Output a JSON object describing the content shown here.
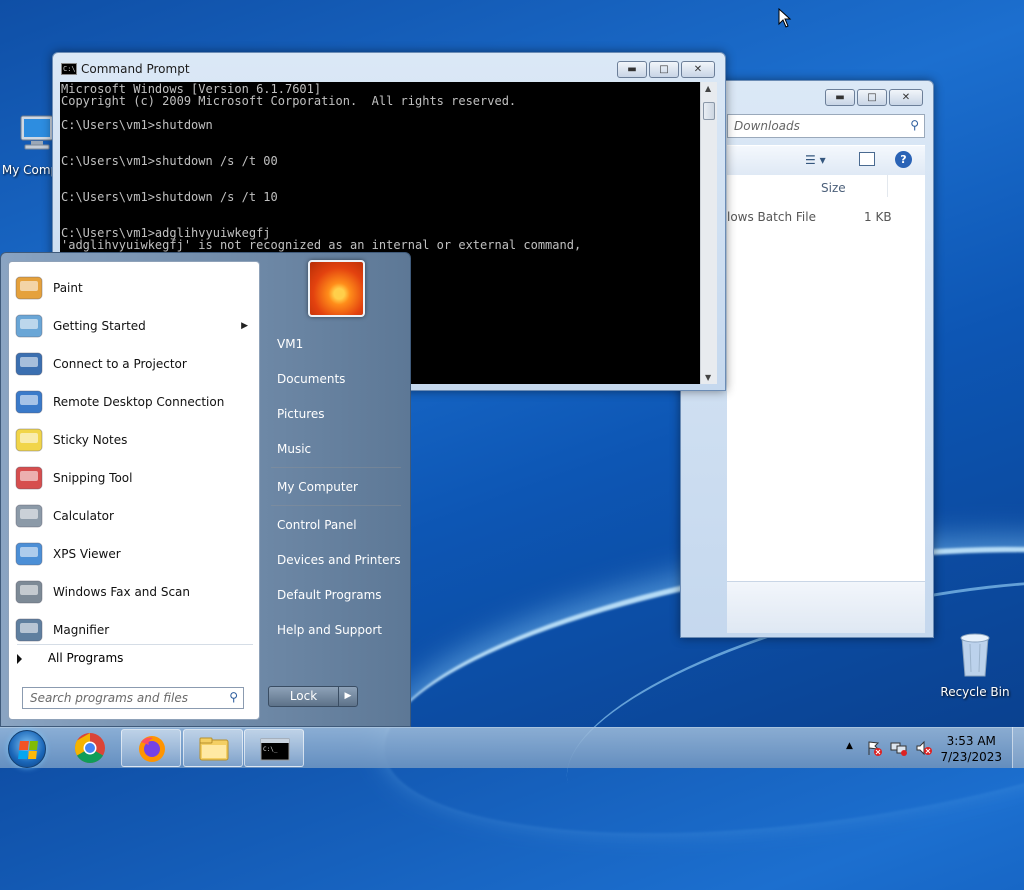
{
  "desktop": {
    "icons": [
      {
        "label": "My Comp",
        "icon": "computer-icon"
      },
      {
        "label": "Recycle Bin",
        "icon": "recycle-bin-icon"
      }
    ]
  },
  "explorer": {
    "search_placeholder": "Downloads",
    "column_size": "Size",
    "file_type": "lows Batch File",
    "file_size": "1 KB"
  },
  "cmd": {
    "title": "Command Prompt",
    "icon_text": "C:\\",
    "lines": "Microsoft Windows [Version 6.1.7601]\nCopyright (c) 2009 Microsoft Corporation.  All rights reserved.\n\nC:\\Users\\vm1>shutdown\n\n\nC:\\Users\\vm1>shutdown /s /t 00\n\n\nC:\\Users\\vm1>shutdown /s /t 10\n\n\nC:\\Users\\vm1>adglihvyuiwkegfj\n'adglihvyuiwkegfj' is not recognized as an internal or external command,"
  },
  "start_menu": {
    "programs": [
      {
        "label": "Paint",
        "icon": "paint-icon",
        "submenu": false
      },
      {
        "label": "Getting Started",
        "icon": "getting-started-icon",
        "submenu": true
      },
      {
        "label": "Connect to a Projector",
        "icon": "projector-icon",
        "submenu": false
      },
      {
        "label": "Remote Desktop Connection",
        "icon": "remote-desktop-icon",
        "submenu": false
      },
      {
        "label": "Sticky Notes",
        "icon": "sticky-notes-icon",
        "submenu": false
      },
      {
        "label": "Snipping Tool",
        "icon": "snipping-tool-icon",
        "submenu": false
      },
      {
        "label": "Calculator",
        "icon": "calculator-icon",
        "submenu": false
      },
      {
        "label": "XPS Viewer",
        "icon": "xps-viewer-icon",
        "submenu": false
      },
      {
        "label": "Windows Fax and Scan",
        "icon": "fax-scan-icon",
        "submenu": false
      },
      {
        "label": "Magnifier",
        "icon": "magnifier-icon",
        "submenu": false
      }
    ],
    "all_programs": "All Programs",
    "search_placeholder": "Search programs and files",
    "right_links": [
      "VM1",
      "Documents",
      "Pictures",
      "Music",
      "My Computer",
      "Control Panel",
      "Devices and Printers",
      "Default Programs",
      "Help and Support"
    ],
    "lock_label": "Lock"
  },
  "taskbar": {
    "time": "3:53 AM",
    "date": "7/23/2023",
    "apps": [
      "chrome-icon",
      "firefox-icon",
      "file-explorer-icon",
      "command-prompt-icon"
    ]
  }
}
